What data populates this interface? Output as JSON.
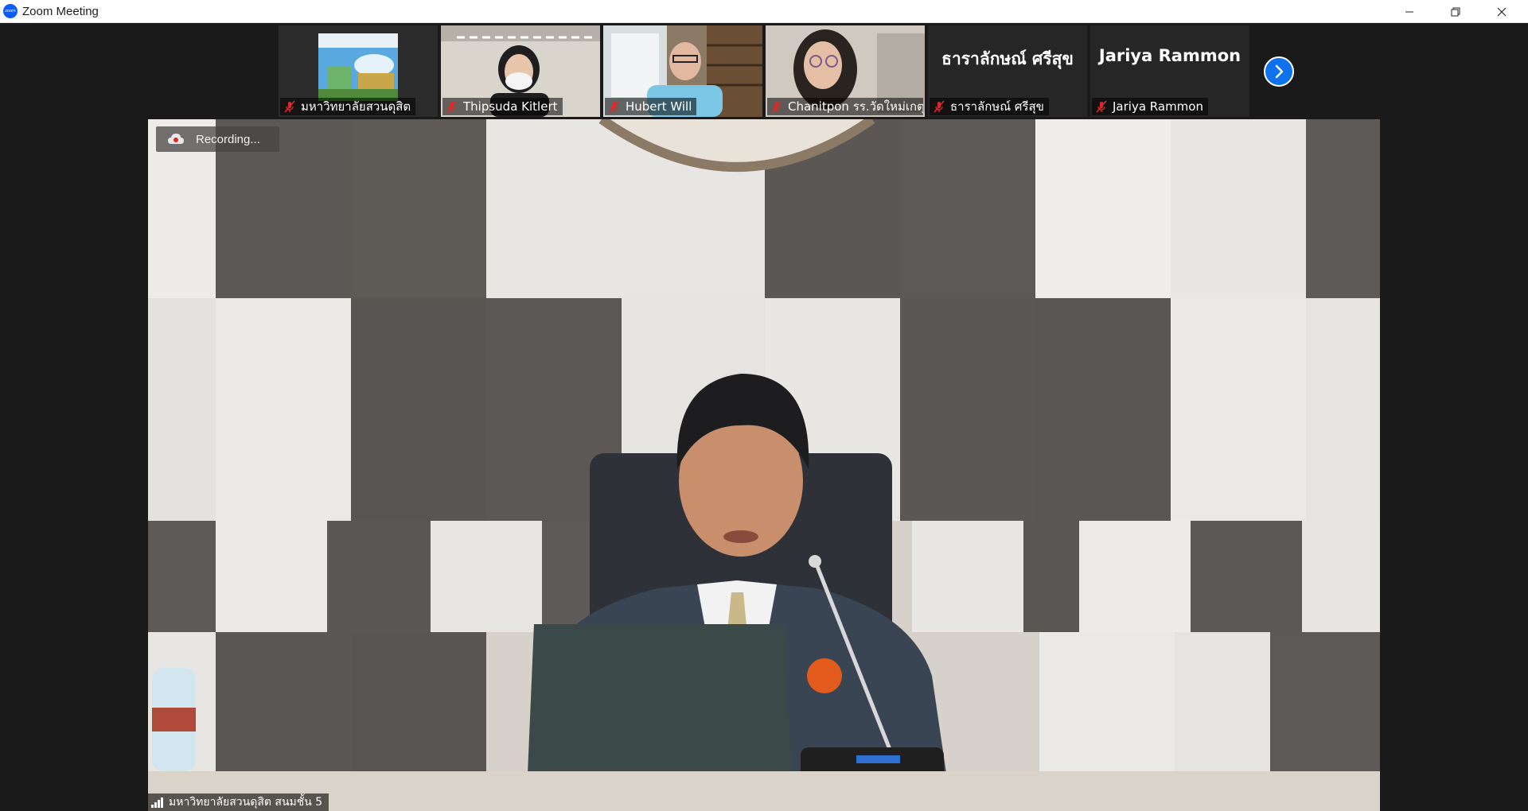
{
  "window": {
    "title": "Zoom Meeting",
    "app_icon_text": "zoom"
  },
  "participants": [
    {
      "name": "มหาวิทยาลัยสวนดุสิต",
      "muted": true,
      "video": true
    },
    {
      "name": "Thipsuda Kitlert",
      "muted": true,
      "video": true
    },
    {
      "name": "Hubert Will",
      "muted": true,
      "video": true
    },
    {
      "name": "Chanitpon รร.วัดใหม่เกตุง...",
      "muted": true,
      "video": true
    },
    {
      "name": "ธาราลักษณ์ ศรีสุข",
      "display_name": "ธาราลักษณ์ ศรีสุข",
      "muted": true,
      "video": false
    },
    {
      "name": "Jariya Rammon",
      "display_name": "Jariya Rammon",
      "muted": true,
      "video": false
    }
  ],
  "main": {
    "recording_label": "Recording...",
    "speaker_name": "มหาวิทยาลัยสวนดุสิต สนมชั้น 5"
  },
  "colors": {
    "accent": "#0e72ed",
    "mute_red": "#e02828"
  }
}
